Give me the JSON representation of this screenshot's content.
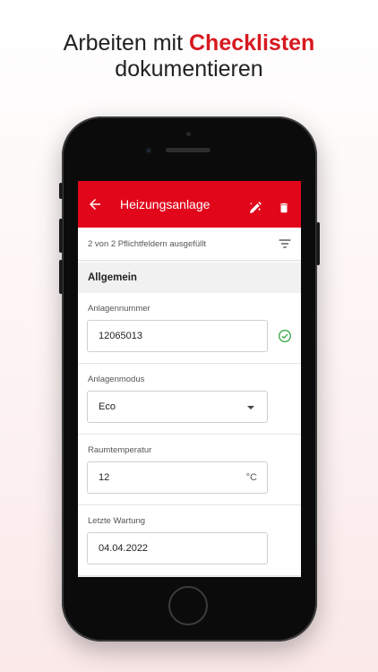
{
  "headline": {
    "line1_prefix": "Arbeiten mit ",
    "line1_accent": "Checklisten",
    "line2": "dokumentieren",
    "accent_color": "#d71920"
  },
  "appbar": {
    "title": "Heizungsanlage",
    "color": "#e2061b",
    "back_icon": "arrow-left-icon",
    "edit_icon": "pencil-sparkle-icon",
    "delete_icon": "trash-icon"
  },
  "progress": {
    "text": "2 von 2 Pflichtfeldern ausgefüllt",
    "filter_icon": "filter-icon"
  },
  "section": {
    "title": "Allgemein"
  },
  "fields": [
    {
      "label": "Anlagennummer",
      "value": "12065013",
      "valid_icon": "check-circle-icon"
    },
    {
      "label": "Anlagenmodus",
      "value": "Eco",
      "caret_icon": "caret-down-icon"
    },
    {
      "label": "Raumtemperatur",
      "value": "12",
      "unit": "°C"
    },
    {
      "label": "Letzte Wartung",
      "value": "04.04.2022"
    }
  ]
}
